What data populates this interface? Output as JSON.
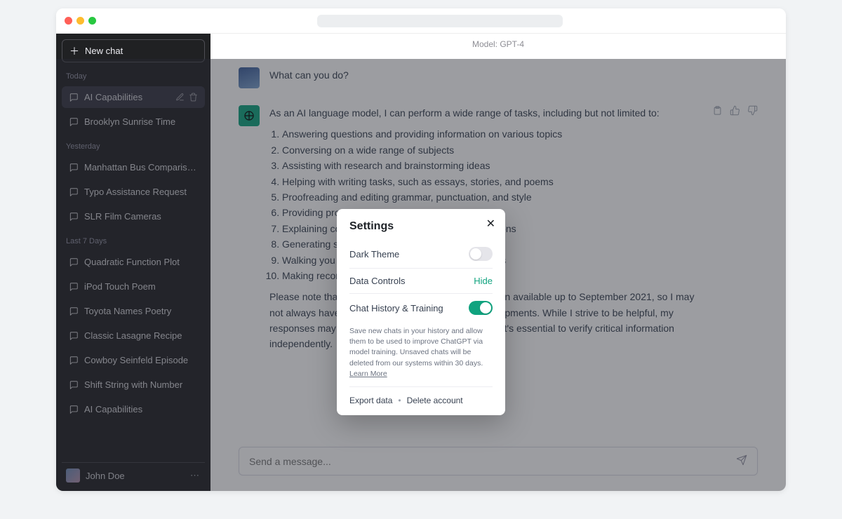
{
  "sidebar": {
    "new_chat": "New chat",
    "sections": [
      {
        "label": "Today",
        "items": [
          {
            "label": "AI Capabilities",
            "active": true
          },
          {
            "label": "Brooklyn Sunrise Time"
          }
        ]
      },
      {
        "label": "Yesterday",
        "items": [
          {
            "label": "Manhattan Bus Comparisons"
          },
          {
            "label": "Typo Assistance Request"
          },
          {
            "label": "SLR Film Cameras"
          }
        ]
      },
      {
        "label": "Last 7 Days",
        "items": [
          {
            "label": "Quadratic Function Plot"
          },
          {
            "label": "iPod Touch Poem"
          },
          {
            "label": "Toyota Names Poetry"
          },
          {
            "label": "Classic Lasagne Recipe"
          },
          {
            "label": "Cowboy Seinfeld Episode"
          },
          {
            "label": "Shift String with Number"
          },
          {
            "label": "AI Capabilities"
          }
        ]
      }
    ],
    "user": "John Doe"
  },
  "main": {
    "model": "Model: GPT-4",
    "user_msg": "What can you do?",
    "assistant_intro": "As an AI language model, I can perform a wide range of tasks, including but not limited to:",
    "assistant_list": [
      "Answering questions and providing information on various topics",
      "Conversing on a wide range of subjects",
      "Assisting with research and brainstorming ideas",
      "Helping with writing tasks, such as essays, stories, and poems",
      "Proofreading and editing grammar, punctuation, and style",
      "Providing programming assistance",
      "Explaining complex concepts and offering translations",
      "Generating summaries",
      "Walking you through step-by-step solutions to tasks",
      "Making recommendations and suggestions"
    ],
    "assistant_outro": "Please note that my knowledge is based on information available up to September 2021, so I may not always have the most recent information or developments. While I strive to be helpful, my responses may not always be perfect or accurate, so it's essential to verify critical information independently.",
    "placeholder": "Send a message..."
  },
  "settings": {
    "title": "Settings",
    "dark_theme": "Dark Theme",
    "data_controls": "Data Controls",
    "hide": "Hide",
    "chat_history": "Chat History & Training",
    "desc": "Save new chats in your history and allow them to be used to improve ChatGPT via model training. Unsaved chats will be deleted from our systems within 30 days.",
    "learn_more": "Learn More",
    "export": "Export data",
    "delete": "Delete account"
  }
}
